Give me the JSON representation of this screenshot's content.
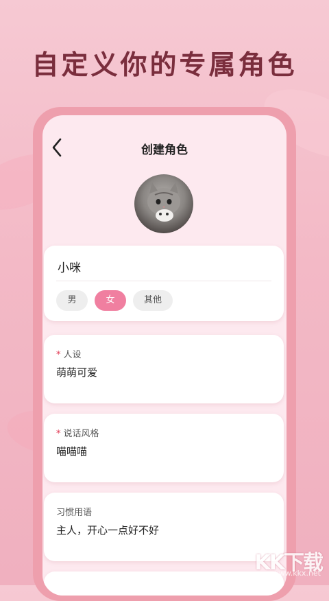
{
  "headline": "自定义你的专属角色",
  "header": {
    "title": "创建角色"
  },
  "profile": {
    "name_value": "小咪",
    "gender_options": [
      "男",
      "女",
      "其他"
    ],
    "selected_gender": "女"
  },
  "fields": [
    {
      "label": "人设",
      "required": "*",
      "value": "萌萌可爱"
    },
    {
      "label": "说话风格",
      "required": "*",
      "value": "喵喵喵"
    },
    {
      "label": "习惯用语",
      "value": "主人，开心一点好不好"
    }
  ],
  "watermark": {
    "brand": "KK下载",
    "site": "www.kkx.net"
  },
  "colors": {
    "accent": "#f07fa0",
    "frame": "#ee9fad",
    "headline": "#7a2e3d"
  }
}
